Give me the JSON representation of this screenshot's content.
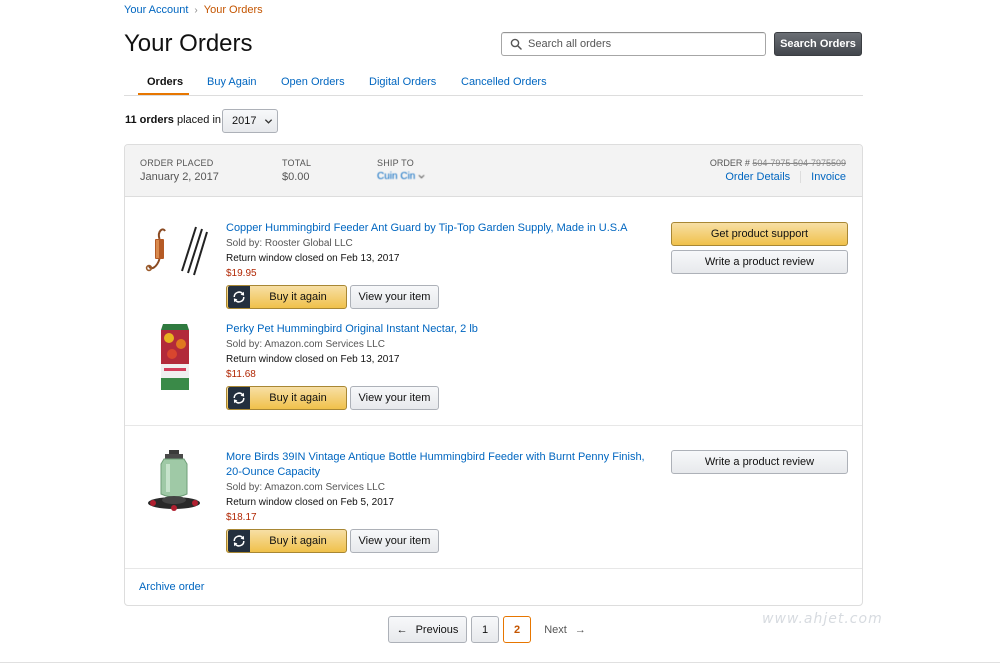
{
  "breadcrumb": {
    "parent": "Your Account",
    "separator": "›",
    "current": "Your Orders"
  },
  "page_title": "Your Orders",
  "search": {
    "placeholder": "Search all orders",
    "value": "",
    "button_label": "Search Orders"
  },
  "tabs": [
    {
      "label": "Orders",
      "active": true
    },
    {
      "label": "Buy Again",
      "active": false
    },
    {
      "label": "Open Orders",
      "active": false
    },
    {
      "label": "Digital Orders",
      "active": false
    },
    {
      "label": "Cancelled Orders",
      "active": false
    }
  ],
  "summary": {
    "count": "11 orders",
    "text": "placed in",
    "year_selected": "2017"
  },
  "order": {
    "placed_label": "ORDER PLACED",
    "placed_value": "January 2, 2017",
    "total_label": "TOTAL",
    "total_value": "$0.00",
    "ship_label": "SHIP TO",
    "ship_value": "Cuin Cin",
    "order_number_label": "ORDER #",
    "order_number_value": "504-7975 504-7975509",
    "details_link": "Order Details",
    "invoice_link": "Invoice"
  },
  "shipments": [
    {
      "items": [
        {
          "title": "Copper Hummingbird Feeder Ant Guard by Tip-Top Garden Supply, Made in U.S.A",
          "sold_by": "Sold by: Rooster Global LLC",
          "return_window": "Return window closed on Feb 13, 2017",
          "price": "$19.95",
          "buy_again": "Buy it again",
          "view_item": "View your item"
        },
        {
          "title": "Perky Pet Hummingbird Original Instant Nectar, 2 lb",
          "sold_by": "Sold by: Amazon.com Services LLC",
          "return_window": "Return window closed on Feb 13, 2017",
          "price": "$11.68",
          "buy_again": "Buy it again",
          "view_item": "View your item"
        }
      ],
      "actions": {
        "primary": "Get product support",
        "secondary": "Write a product review"
      }
    },
    {
      "items": [
        {
          "title": "More Birds 39IN Vintage Antique Bottle Hummingbird Feeder with Burnt Penny Finish, 20-Ounce Capacity",
          "sold_by": "Sold by: Amazon.com Services LLC",
          "return_window": "Return window closed on Feb 5, 2017",
          "price": "$18.17",
          "buy_again": "Buy it again",
          "view_item": "View your item"
        }
      ],
      "actions": {
        "secondary": "Write a product review"
      }
    }
  ],
  "archive_link": "Archive order",
  "pagination": {
    "previous": "Previous",
    "pages": [
      "1",
      "2"
    ],
    "current": "2",
    "next": "Next",
    "prev_arrow": "←",
    "next_arrow": "→"
  },
  "watermark": "www.ahjet.com",
  "colors": {
    "link": "#0066c0",
    "price": "#b12704",
    "accent": "#e77600",
    "button_yellow": "#f0c14b",
    "dark_button": "#42464c"
  }
}
